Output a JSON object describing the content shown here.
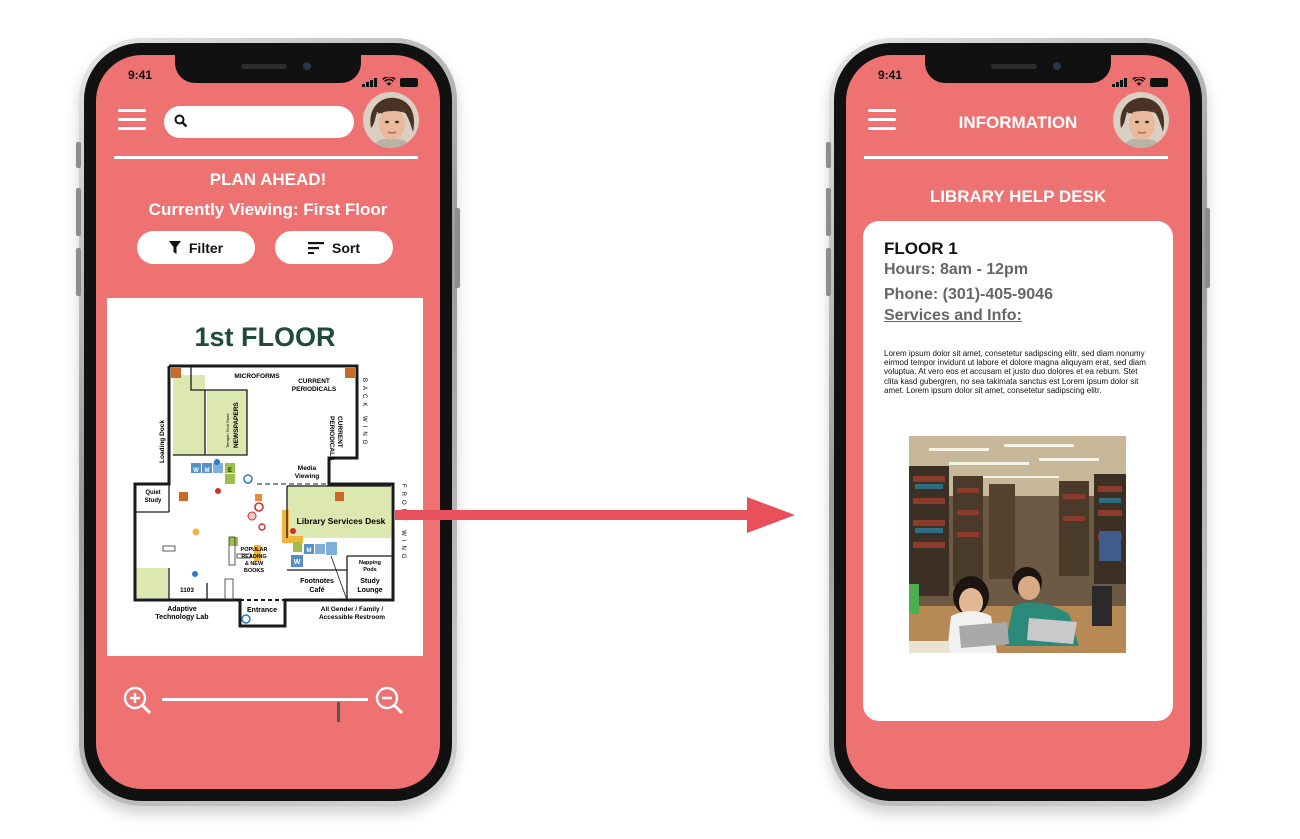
{
  "phone_left": {
    "status_time": "9:41",
    "search": {
      "value": "",
      "placeholder": ""
    },
    "plan_heading": "PLAN AHEAD!",
    "viewing_text": "Currently Viewing: First Floor",
    "filter_label": "Filter",
    "sort_label": "Sort",
    "map": {
      "title": "1st FLOOR",
      "labels": {
        "microforms": "MICROFORMS",
        "current_periodicals_a": "CURRENT",
        "current_periodicals_b": "PERIODICALS",
        "current_periodicals_v1": "CURRENT",
        "current_periodicals_v2": "PERIODICALS",
        "back_wing": "BACK WING",
        "front_wing": "FRONT WING",
        "loading_dock": "Loading Dock",
        "newspapers": "NEWSPAPERS",
        "terrapin_store": "Terrapin Tech Store",
        "media_viewing_a": "Media",
        "media_viewing_b": "Viewing",
        "quiet_study_a": "Quiet",
        "quiet_study_b": "Study",
        "library_services_desk": "Library Services Desk",
        "popular_reading_a": "POPULAR",
        "popular_reading_b": "READING",
        "popular_reading_c": "& NEW",
        "popular_reading_d": "BOOKS",
        "napping_pods_a": "Napping",
        "napping_pods_b": "Pods",
        "footnotes_cafe_a": "Footnotes",
        "footnotes_cafe_b": "Café",
        "study_lounge_a": "Study",
        "study_lounge_b": "Lounge",
        "room_1103": "1103",
        "adaptive_lab_a": "Adaptive",
        "adaptive_lab_b": "Technology Lab",
        "entrance": "Entrance",
        "restroom_a": "All Gender / Family /",
        "restroom_b": "Accessible Restroom",
        "w": "W",
        "m": "M",
        "e": "E"
      }
    },
    "zoom": {
      "level": 0.86
    }
  },
  "phone_right": {
    "status_time": "9:41",
    "screen_title": "INFORMATION",
    "section_title": "LIBRARY HELP DESK",
    "floor": "FLOOR 1",
    "hours": "Hours: 8am - 12pm",
    "phone": "Phone: (301)-405-9046",
    "services": "Services and Info:",
    "body_text": "Lorem ipsum dolor sit amet, consetetur sadipscing elitr, sed diam nonumy eirmod tempor invidunt ut labore et dolore magna aliquyam erat, sed diam voluptua. At vero eos et accusam et justo duo dolores et ea rebum. Stet clita kasd gubergren, no sea takimata sanctus est Lorem ipsum dolor sit amet. Lorem ipsum dolor sit amet, consetetur sadipscing elitr."
  },
  "colors": {
    "screen_bg": "#ee7271",
    "arrow": "#e8505b",
    "map_green": "#dde7b0",
    "map_dark_green": "#1e4b3c",
    "desk_orange": "#f3b33d"
  },
  "icons": [
    "hamburger-icon",
    "search-icon",
    "filter-icon",
    "sort-icon",
    "zoom-in-icon",
    "zoom-out-icon",
    "signal-icon",
    "wifi-icon",
    "battery-icon"
  ]
}
